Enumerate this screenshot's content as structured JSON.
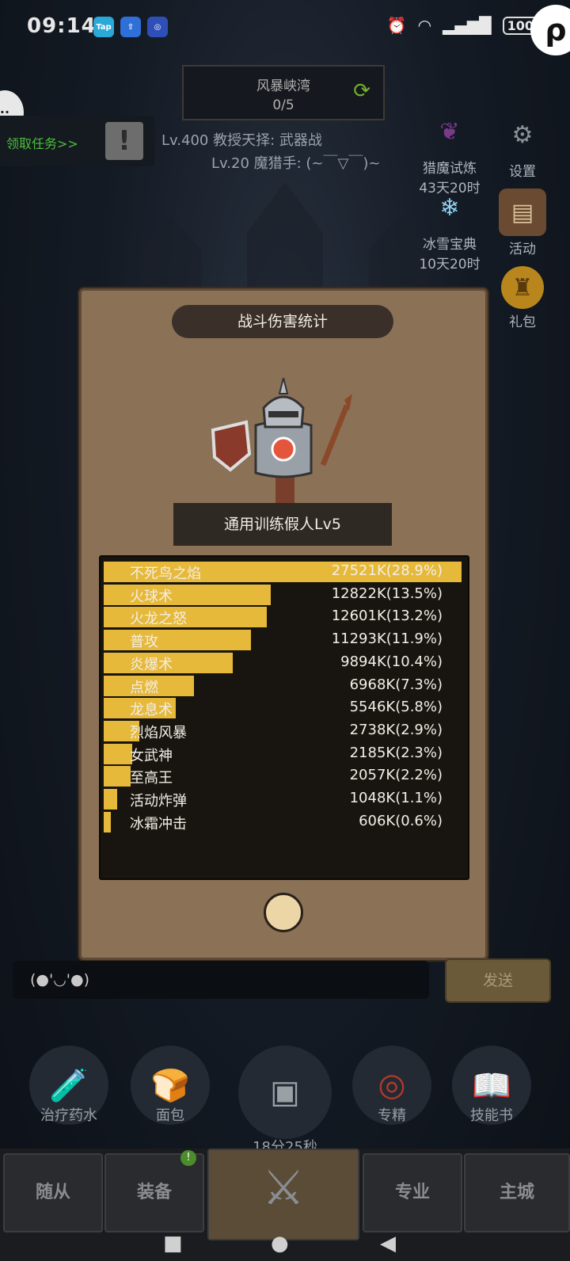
{
  "status_bar": {
    "time": "09:14",
    "apps": [
      "Tap",
      "⇧",
      "◎"
    ],
    "battery": "100"
  },
  "hud": {
    "region_name": "风暴峡湾",
    "region_progress": "0/5",
    "quest_label": "领取任务>>",
    "info_line1": "Lv.400 教授天择: 武器战",
    "info_line2": "Lv.20 魔猎手: (~￣▽￣)~",
    "side_buttons": [
      {
        "label": "猎魔试炼",
        "sub": "43天20时"
      },
      {
        "label": "设置"
      },
      {
        "label": "冰雪宝典",
        "sub": "10天20时"
      },
      {
        "label": "活动"
      },
      {
        "label": "礼包"
      }
    ]
  },
  "modal": {
    "title": "战斗伤害统计",
    "target_name": "通用训练假人Lv5",
    "rows": [
      {
        "skill": "不死鸟之焰",
        "value": "27521K(28.9%)",
        "share": 0.289
      },
      {
        "skill": "火球术",
        "value": "12822K(13.5%)",
        "share": 0.135
      },
      {
        "skill": "火龙之怒",
        "value": "12601K(13.2%)",
        "share": 0.132
      },
      {
        "skill": "普攻",
        "value": "11293K(11.9%)",
        "share": 0.119
      },
      {
        "skill": "炎爆术",
        "value": "9894K(10.4%)",
        "share": 0.104
      },
      {
        "skill": "点燃",
        "value": "6968K(7.3%)",
        "share": 0.073
      },
      {
        "skill": "龙息术",
        "value": "5546K(5.8%)",
        "share": 0.058
      },
      {
        "skill": "烈焰风暴",
        "value": "2738K(2.9%)",
        "share": 0.029
      },
      {
        "skill": "女武神",
        "value": "2185K(2.3%)",
        "share": 0.023
      },
      {
        "skill": "至高王",
        "value": "2057K(2.2%)",
        "share": 0.022
      },
      {
        "skill": "活动炸弹",
        "value": "1048K(1.1%)",
        "share": 0.011
      },
      {
        "skill": "冰霜冲击",
        "value": "606K(0.6%)",
        "share": 0.006
      }
    ]
  },
  "chat": {
    "placeholder": "(●'◡'●)",
    "send_label": "发送"
  },
  "quick_items": [
    {
      "label": "治疗药水",
      "icon": "potion-icon"
    },
    {
      "label": "面包",
      "icon": "bread-icon"
    },
    {
      "label": "18分25秒",
      "icon": "chest-icon"
    },
    {
      "label": "专精",
      "icon": "spec-icon"
    },
    {
      "label": "技能书",
      "icon": "book-icon"
    }
  ],
  "tabs": [
    {
      "label": "随从"
    },
    {
      "label": "装备",
      "badge": "!"
    },
    {
      "label": "战斗"
    },
    {
      "label": "专业"
    },
    {
      "label": "主城"
    }
  ],
  "colors": {
    "bar": "#e6b93a",
    "panel": "#8b7257",
    "stats_bg": "#18140f"
  }
}
